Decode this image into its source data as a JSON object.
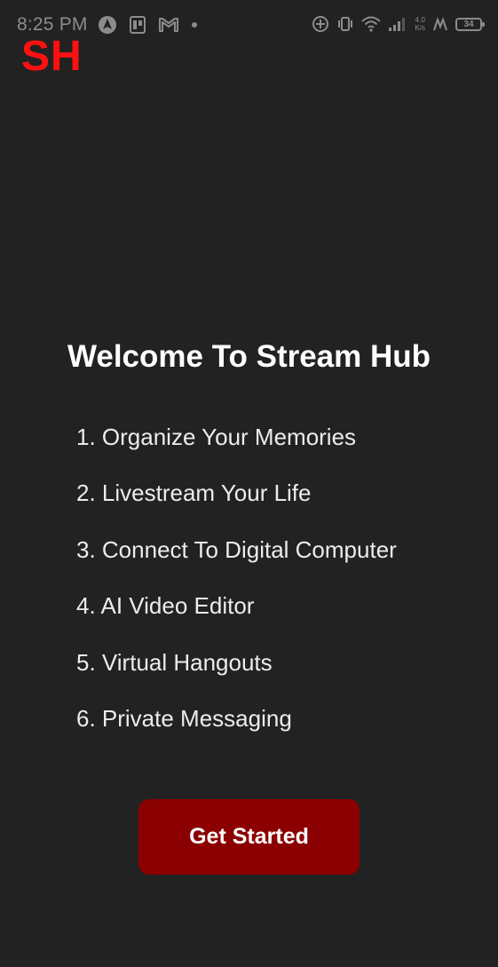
{
  "status_bar": {
    "time": "8:25 PM",
    "left_icons": [
      "navigation-arrow-icon",
      "pdf-icon",
      "gmail-icon",
      "notification-dot-icon"
    ],
    "right_icons": [
      "data-saver-icon",
      "vibrate-icon",
      "wifi-icon",
      "signal-icon",
      "sim-icon"
    ],
    "net_speed_value": "4.0",
    "net_speed_unit": "K/s",
    "battery_level": "34"
  },
  "app": {
    "logo_text": "SH",
    "logo_color": "#ff1010",
    "background_color": "#222222"
  },
  "welcome": {
    "title": "Welcome To Stream Hub",
    "features": [
      "1. Organize Your Memories",
      "2. Livestream Your Life",
      "3. Connect To Digital Computer",
      "4. AI Video Editor",
      "5. Virtual Hangouts",
      "6. Private Messaging"
    ]
  },
  "cta": {
    "label": "Get Started",
    "color": "#8b0000"
  }
}
